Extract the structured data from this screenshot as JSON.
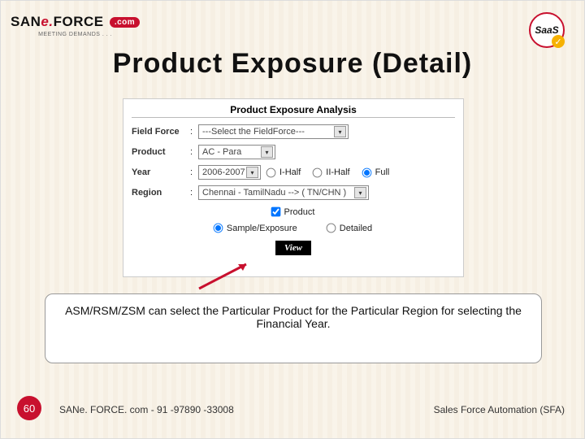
{
  "header": {
    "brand_san": "SAN",
    "brand_e": "e.",
    "brand_force": "FORCE",
    "brand_dotcom": ".com",
    "brand_tagline": "MEETING DEMANDS . . .",
    "saas_badge": "SaaS"
  },
  "title": "Product Exposure (Detail)",
  "panel": {
    "heading": "Product Exposure Analysis",
    "labels": {
      "field_force": "Field Force",
      "product": "Product",
      "year": "Year",
      "region": "Region"
    },
    "values": {
      "field_force": "---Select the FieldForce---",
      "product": "AC - Para",
      "year": "2006-2007",
      "region": "Chennai - TamilNadu --> ( TN/CHN )"
    },
    "radios": {
      "i_half": "I-Half",
      "ii_half": "II-Half",
      "full": "Full",
      "sample_exposure": "Sample/Exposure",
      "detailed": "Detailed"
    },
    "checkbox_product": "Product",
    "view_button": "View"
  },
  "caption": "ASM/RSM/ZSM can select the Particular Product for the Particular Region for selecting the Financial Year.",
  "footer": {
    "slide_number": "60",
    "left": "SANe. FORCE. com - 91 -97890 -33008",
    "right": "Sales Force Automation (SFA)"
  }
}
